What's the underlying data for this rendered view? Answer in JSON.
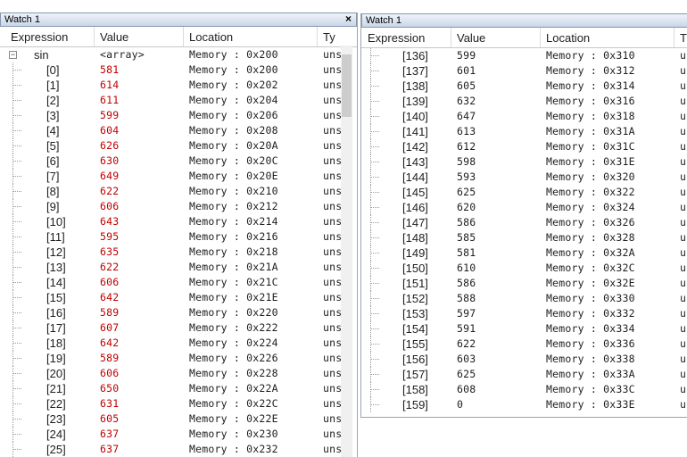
{
  "left_pane": {
    "title": "Watch 1",
    "close_label": "×",
    "columns": [
      "Expression",
      "Value",
      "Location",
      "Ty"
    ],
    "root": {
      "expander": "−",
      "expression": "sin",
      "value": "<array>",
      "location": "Memory : 0x200",
      "type": "uns"
    },
    "rows": [
      {
        "expression": "[0]",
        "value": "581",
        "location": "Memory : 0x200",
        "type": "uns"
      },
      {
        "expression": "[1]",
        "value": "614",
        "location": "Memory : 0x202",
        "type": "uns"
      },
      {
        "expression": "[2]",
        "value": "611",
        "location": "Memory : 0x204",
        "type": "uns"
      },
      {
        "expression": "[3]",
        "value": "599",
        "location": "Memory : 0x206",
        "type": "uns"
      },
      {
        "expression": "[4]",
        "value": "604",
        "location": "Memory : 0x208",
        "type": "uns"
      },
      {
        "expression": "[5]",
        "value": "626",
        "location": "Memory : 0x20A",
        "type": "uns"
      },
      {
        "expression": "[6]",
        "value": "630",
        "location": "Memory : 0x20C",
        "type": "uns"
      },
      {
        "expression": "[7]",
        "value": "649",
        "location": "Memory : 0x20E",
        "type": "uns"
      },
      {
        "expression": "[8]",
        "value": "622",
        "location": "Memory : 0x210",
        "type": "uns"
      },
      {
        "expression": "[9]",
        "value": "606",
        "location": "Memory : 0x212",
        "type": "uns"
      },
      {
        "expression": "[10]",
        "value": "643",
        "location": "Memory : 0x214",
        "type": "uns"
      },
      {
        "expression": "[11]",
        "value": "595",
        "location": "Memory : 0x216",
        "type": "uns"
      },
      {
        "expression": "[12]",
        "value": "635",
        "location": "Memory : 0x218",
        "type": "uns"
      },
      {
        "expression": "[13]",
        "value": "622",
        "location": "Memory : 0x21A",
        "type": "uns"
      },
      {
        "expression": "[14]",
        "value": "606",
        "location": "Memory : 0x21C",
        "type": "uns"
      },
      {
        "expression": "[15]",
        "value": "642",
        "location": "Memory : 0x21E",
        "type": "uns"
      },
      {
        "expression": "[16]",
        "value": "589",
        "location": "Memory : 0x220",
        "type": "uns"
      },
      {
        "expression": "[17]",
        "value": "607",
        "location": "Memory : 0x222",
        "type": "uns"
      },
      {
        "expression": "[18]",
        "value": "642",
        "location": "Memory : 0x224",
        "type": "uns"
      },
      {
        "expression": "[19]",
        "value": "589",
        "location": "Memory : 0x226",
        "type": "uns"
      },
      {
        "expression": "[20]",
        "value": "606",
        "location": "Memory : 0x228",
        "type": "uns"
      },
      {
        "expression": "[21]",
        "value": "650",
        "location": "Memory : 0x22A",
        "type": "uns"
      },
      {
        "expression": "[22]",
        "value": "631",
        "location": "Memory : 0x22C",
        "type": "uns"
      },
      {
        "expression": "[23]",
        "value": "605",
        "location": "Memory : 0x22E",
        "type": "uns"
      },
      {
        "expression": "[24]",
        "value": "637",
        "location": "Memory : 0x230",
        "type": "uns"
      },
      {
        "expression": "[25]",
        "value": "637",
        "location": "Memory : 0x232",
        "type": "uns"
      }
    ]
  },
  "right_pane": {
    "title": "Watch 1",
    "columns": [
      "Expression",
      "Value",
      "Location",
      "T"
    ],
    "rows": [
      {
        "expression": "[136]",
        "value": "599",
        "location": "Memory : 0x310",
        "type": "u"
      },
      {
        "expression": "[137]",
        "value": "601",
        "location": "Memory : 0x312",
        "type": "u"
      },
      {
        "expression": "[138]",
        "value": "605",
        "location": "Memory : 0x314",
        "type": "u"
      },
      {
        "expression": "[139]",
        "value": "632",
        "location": "Memory : 0x316",
        "type": "u"
      },
      {
        "expression": "[140]",
        "value": "647",
        "location": "Memory : 0x318",
        "type": "u"
      },
      {
        "expression": "[141]",
        "value": "613",
        "location": "Memory : 0x31A",
        "type": "u"
      },
      {
        "expression": "[142]",
        "value": "612",
        "location": "Memory : 0x31C",
        "type": "u"
      },
      {
        "expression": "[143]",
        "value": "598",
        "location": "Memory : 0x31E",
        "type": "u"
      },
      {
        "expression": "[144]",
        "value": "593",
        "location": "Memory : 0x320",
        "type": "u"
      },
      {
        "expression": "[145]",
        "value": "625",
        "location": "Memory : 0x322",
        "type": "u"
      },
      {
        "expression": "[146]",
        "value": "620",
        "location": "Memory : 0x324",
        "type": "u"
      },
      {
        "expression": "[147]",
        "value": "586",
        "location": "Memory : 0x326",
        "type": "u"
      },
      {
        "expression": "[148]",
        "value": "585",
        "location": "Memory : 0x328",
        "type": "u"
      },
      {
        "expression": "[149]",
        "value": "581",
        "location": "Memory : 0x32A",
        "type": "u"
      },
      {
        "expression": "[150]",
        "value": "610",
        "location": "Memory : 0x32C",
        "type": "u"
      },
      {
        "expression": "[151]",
        "value": "586",
        "location": "Memory : 0x32E",
        "type": "u"
      },
      {
        "expression": "[152]",
        "value": "588",
        "location": "Memory : 0x330",
        "type": "u"
      },
      {
        "expression": "[153]",
        "value": "597",
        "location": "Memory : 0x332",
        "type": "u"
      },
      {
        "expression": "[154]",
        "value": "591",
        "location": "Memory : 0x334",
        "type": "u"
      },
      {
        "expression": "[155]",
        "value": "622",
        "location": "Memory : 0x336",
        "type": "u"
      },
      {
        "expression": "[156]",
        "value": "603",
        "location": "Memory : 0x338",
        "type": "u"
      },
      {
        "expression": "[157]",
        "value": "625",
        "location": "Memory : 0x33A",
        "type": "u"
      },
      {
        "expression": "[158]",
        "value": "608",
        "location": "Memory : 0x33C",
        "type": "u"
      },
      {
        "expression": "[159]",
        "value": "0",
        "location": "Memory : 0x33E",
        "type": "u"
      }
    ]
  },
  "colors": {
    "changed_value": "#c00000",
    "normal_value": "#1e1e1e",
    "titlebar": "#c9d6e8"
  }
}
